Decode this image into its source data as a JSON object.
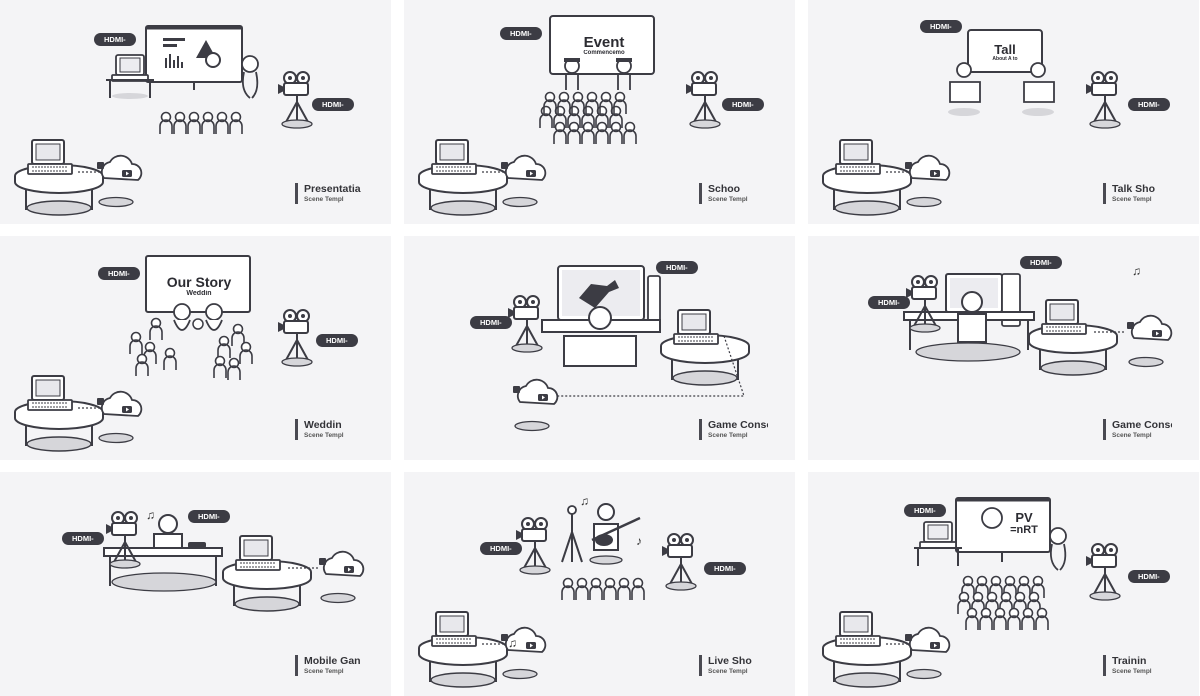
{
  "panels": [
    {
      "title": "Presentatia",
      "subtitle": "Scene Templ",
      "hdmi": [
        "HDMI-",
        "HDMI-"
      ]
    },
    {
      "title": "Schoo",
      "subtitle": "Scene Templ",
      "hdmi": [
        "HDMI-",
        "HDMI-"
      ],
      "board": {
        "line1": "Event",
        "line2": "Commencemo"
      }
    },
    {
      "title": "Talk Sho",
      "subtitle": "Scene Templ",
      "hdmi": [
        "HDMI-",
        "HDMI-"
      ],
      "board": {
        "line1": "Tall",
        "line2": "About A to"
      }
    },
    {
      "title": "Weddin",
      "subtitle": "Scene Templ",
      "hdmi": [
        "HDMI-",
        "HDMI-"
      ],
      "board": {
        "line1": "Our Story",
        "line2": "Weddin"
      }
    },
    {
      "title": "Game Conso",
      "subtitle": "Scene Templ",
      "hdmi": [
        "HDMI-",
        "HDMI-"
      ]
    },
    {
      "title": "Game Conso",
      "subtitle": "Scene Templ",
      "hdmi": [
        "HDMI-",
        "HDMI-"
      ]
    },
    {
      "title": "Mobile Gan",
      "subtitle": "Scene Templ",
      "hdmi": [
        "HDMI-",
        "HDMI-"
      ]
    },
    {
      "title": "Live Sho",
      "subtitle": "Scene Templ",
      "hdmi": [
        "HDMI-",
        "HDMI-"
      ]
    },
    {
      "title": "Trainin",
      "subtitle": "Scene Templ",
      "hdmi": [
        "HDMI-",
        "HDMI-"
      ],
      "board": {
        "line1": "PV",
        "line2": "=nRT"
      }
    }
  ],
  "colors": {
    "panel_bg": "#f4f4f6",
    "ink": "#3c3c44",
    "shadow": "#d6d6da"
  },
  "icons": [
    "laptop-icon",
    "camera-icon",
    "cloud-live-icon",
    "screen-icon",
    "person-icon",
    "audience-icon",
    "music-note-icon"
  ]
}
